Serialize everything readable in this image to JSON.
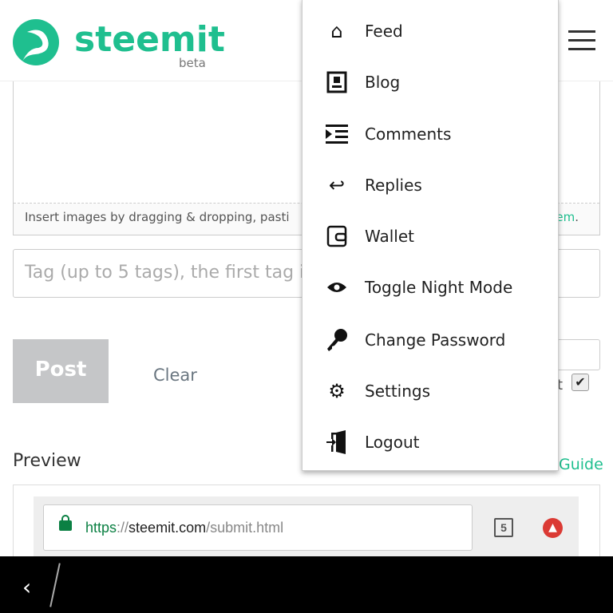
{
  "header": {
    "brand": "steemit",
    "beta": "beta",
    "brand_color": "#1fbf8f"
  },
  "editor": {
    "hint_left": "Insert images by dragging & dropping, pasti",
    "hint_link": "em",
    "hint_end": "."
  },
  "tags": {
    "placeholder": "Tag (up to 5 tags), the first tag is y"
  },
  "actions": {
    "post": "Post",
    "clear": "Clear",
    "checkbox_label": "t",
    "checked": true
  },
  "preview": {
    "title": "Preview",
    "guide": "Guide"
  },
  "browser": {
    "scheme": "https",
    "sep": "://",
    "domain": "steemit.com",
    "path": "/submit.html",
    "tab_count": "5"
  },
  "menu": {
    "items": [
      {
        "label": "Feed",
        "icon": "home-icon"
      },
      {
        "label": "Blog",
        "icon": "blog-icon"
      },
      {
        "label": "Comments",
        "icon": "comments-icon"
      },
      {
        "label": "Replies",
        "icon": "reply-icon"
      },
      {
        "label": "Wallet",
        "icon": "wallet-icon"
      },
      {
        "label": "Toggle Night Mode",
        "icon": "eye-icon"
      },
      {
        "label": "Change Password",
        "icon": "key-icon"
      },
      {
        "label": "Settings",
        "icon": "gear-icon"
      },
      {
        "label": "Logout",
        "icon": "logout-icon"
      }
    ]
  }
}
